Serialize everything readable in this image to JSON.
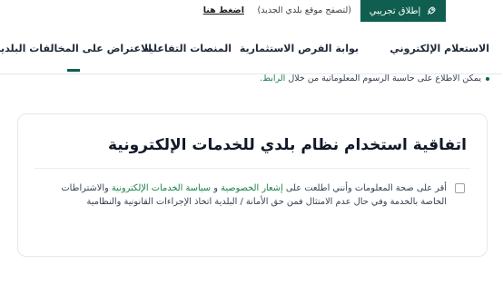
{
  "topbar": {
    "beta_label": "إطلاق تجريبي",
    "beta_note": "(لتصفح موقع بلدي الجديد)",
    "beta_link": "اضغط هنا"
  },
  "nav": {
    "items": [
      {
        "label": "الاستعلام الإلكتروني"
      },
      {
        "label": "بوابة الفرص الاستثمارية"
      },
      {
        "label": "المنصات التفاعلية"
      },
      {
        "label": "الاعتراض على المخالفات البلدية"
      }
    ],
    "active_index": 3
  },
  "notice": {
    "text": "يمكن الاطلاع على حاسبة الرسوم المعلوماتية من خلال",
    "link": "الرابط."
  },
  "agreement": {
    "title": "اتفاقية استخدام نظام بلدي للخدمات الإلكترونية",
    "text_1": "أقر على صحة المعلومات وأنني اطلعت على",
    "privacy_link": "إشعار الخصوصية",
    "and": "و",
    "policy_link": "سياسة الخدمات الإلكترونية",
    "text_2": "والاشتراطات الخاصة بالخدمة وفي حال عدم الامتثال فمن حق الأمانة / البلدية اتخاذ الإجراءات القانونية والنظامية"
  },
  "colors": {
    "brand": "#0f5e4f",
    "link": "#1a7f4b"
  }
}
